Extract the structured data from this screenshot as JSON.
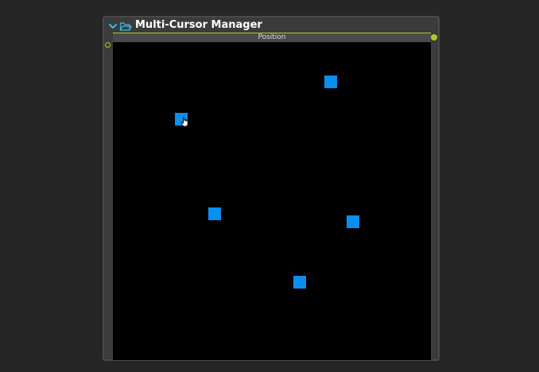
{
  "node": {
    "title": "Multi-Cursor Manager",
    "param_label": "Position",
    "accent_color": "#a5d022",
    "icons": {
      "collapse": "chevron-down-icon",
      "folder": "folder-open-icon",
      "pointer": "hand-pointer-icon"
    }
  },
  "cursors": {
    "color": "#0a8ef0",
    "count": 5
  }
}
